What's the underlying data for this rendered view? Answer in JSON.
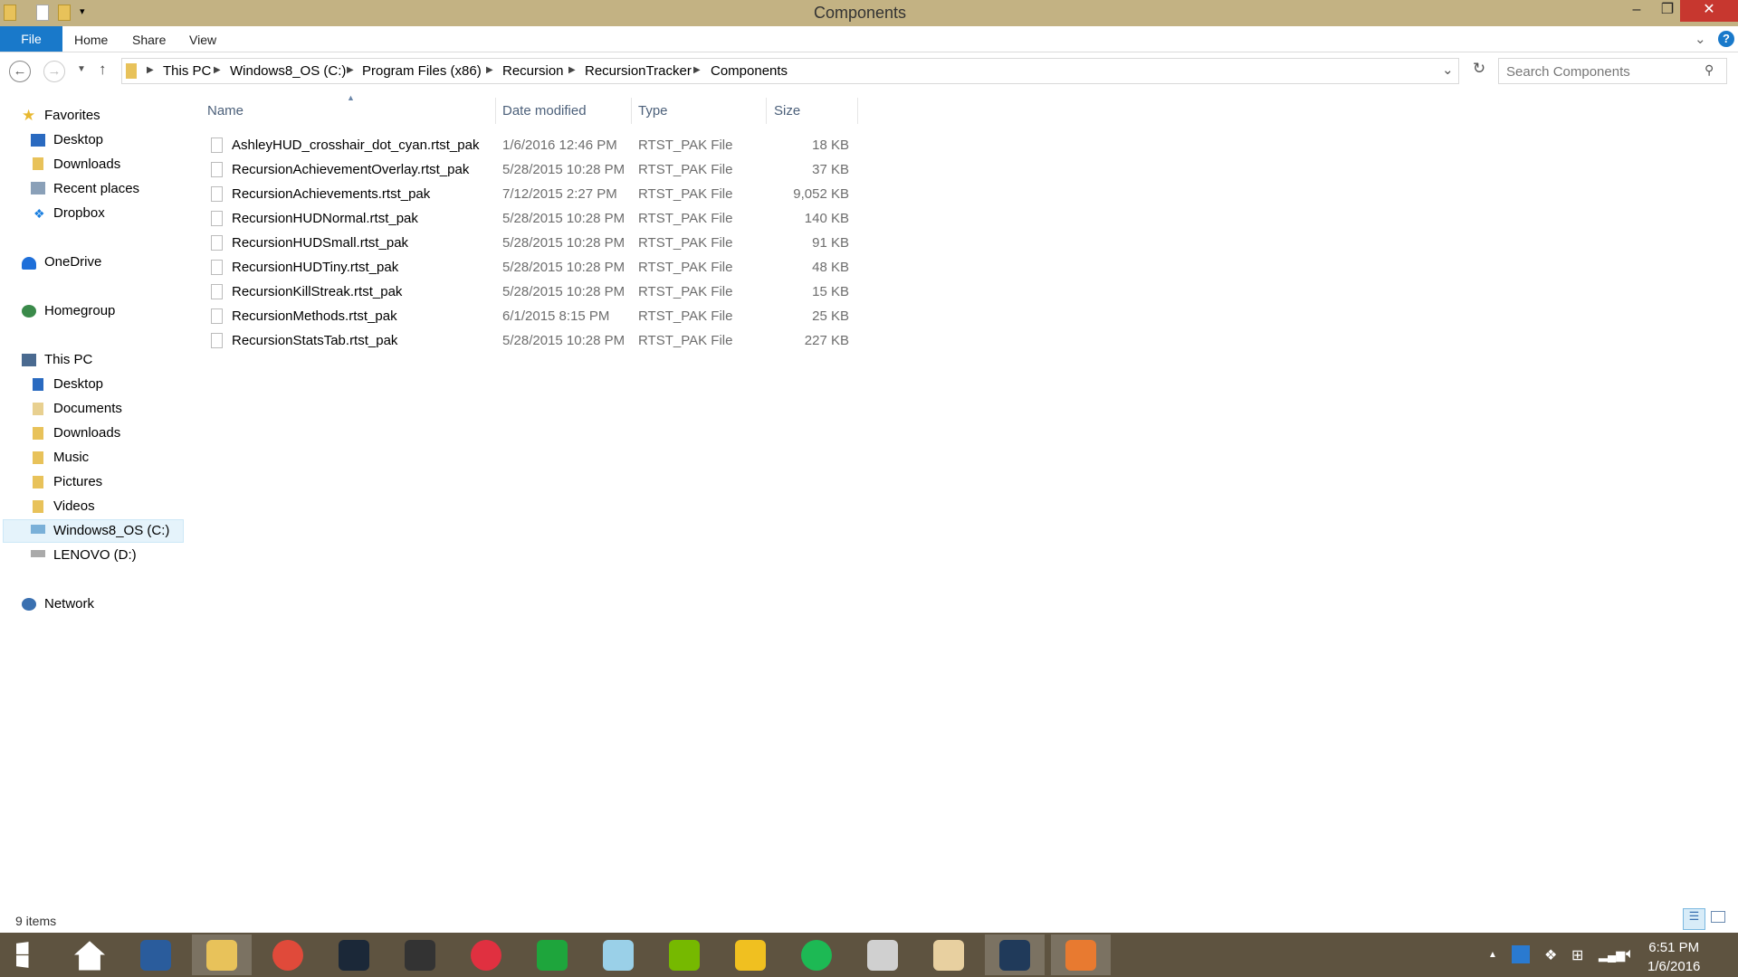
{
  "window": {
    "title": "Components"
  },
  "ribbon": {
    "tabs": [
      "File",
      "Home",
      "Share",
      "View"
    ]
  },
  "address": {
    "crumbs": [
      "This PC",
      "Windows8_OS (C:)",
      "Program Files (x86)",
      "Recursion",
      "RecursionTracker",
      "Components"
    ]
  },
  "search": {
    "placeholder": "Search Components"
  },
  "sidebar": {
    "favorites": {
      "label": "Favorites",
      "items": [
        "Desktop",
        "Downloads",
        "Recent places",
        "Dropbox"
      ]
    },
    "onedrive": "OneDrive",
    "homegroup": "Homegroup",
    "thispc": {
      "label": "This PC",
      "items": [
        "Desktop",
        "Documents",
        "Downloads",
        "Music",
        "Pictures",
        "Videos",
        "Windows8_OS (C:)",
        "LENOVO (D:)"
      ]
    },
    "network": "Network"
  },
  "columns": [
    "Name",
    "Date modified",
    "Type",
    "Size"
  ],
  "files": [
    {
      "name": "AshleyHUD_crosshair_dot_cyan.rtst_pak",
      "date": "1/6/2016 12:46 PM",
      "type": "RTST_PAK File",
      "size": "18 KB"
    },
    {
      "name": "RecursionAchievementOverlay.rtst_pak",
      "date": "5/28/2015 10:28 PM",
      "type": "RTST_PAK File",
      "size": "37 KB"
    },
    {
      "name": "RecursionAchievements.rtst_pak",
      "date": "7/12/2015 2:27 PM",
      "type": "RTST_PAK File",
      "size": "9,052 KB"
    },
    {
      "name": "RecursionHUDNormal.rtst_pak",
      "date": "5/28/2015 10:28 PM",
      "type": "RTST_PAK File",
      "size": "140 KB"
    },
    {
      "name": "RecursionHUDSmall.rtst_pak",
      "date": "5/28/2015 10:28 PM",
      "type": "RTST_PAK File",
      "size": "91 KB"
    },
    {
      "name": "RecursionHUDTiny.rtst_pak",
      "date": "5/28/2015 10:28 PM",
      "type": "RTST_PAK File",
      "size": "48 KB"
    },
    {
      "name": "RecursionKillStreak.rtst_pak",
      "date": "5/28/2015 10:28 PM",
      "type": "RTST_PAK File",
      "size": "15 KB"
    },
    {
      "name": "RecursionMethods.rtst_pak",
      "date": "6/1/2015 8:15 PM",
      "type": "RTST_PAK File",
      "size": "25 KB"
    },
    {
      "name": "RecursionStatsTab.rtst_pak",
      "date": "5/28/2015 10:28 PM",
      "type": "RTST_PAK File",
      "size": "227 KB"
    }
  ],
  "status": {
    "count": "9 items"
  },
  "taskbar": {
    "apps": [
      "start",
      "home",
      "lenovo-monitor",
      "file-explorer",
      "chrome",
      "steam",
      "app-u",
      "itunes",
      "store",
      "notes",
      "nvidia",
      "bluestacks",
      "spotify",
      "calculator",
      "paint",
      "recursion",
      "app-x"
    ],
    "colors": [
      "#1e6fd9",
      "#ffffff",
      "#2a5c9c",
      "#e8c25a",
      "#e04a3a",
      "#1b2838",
      "#333333",
      "#e03040",
      "#1ea53c",
      "#9ad0e8",
      "#76b900",
      "#f0c020",
      "#1db954",
      "#d0d0d0",
      "#e8d0a0",
      "#203a5a",
      "#e87a30"
    ],
    "time": "6:51 PM",
    "date": "1/6/2016"
  }
}
